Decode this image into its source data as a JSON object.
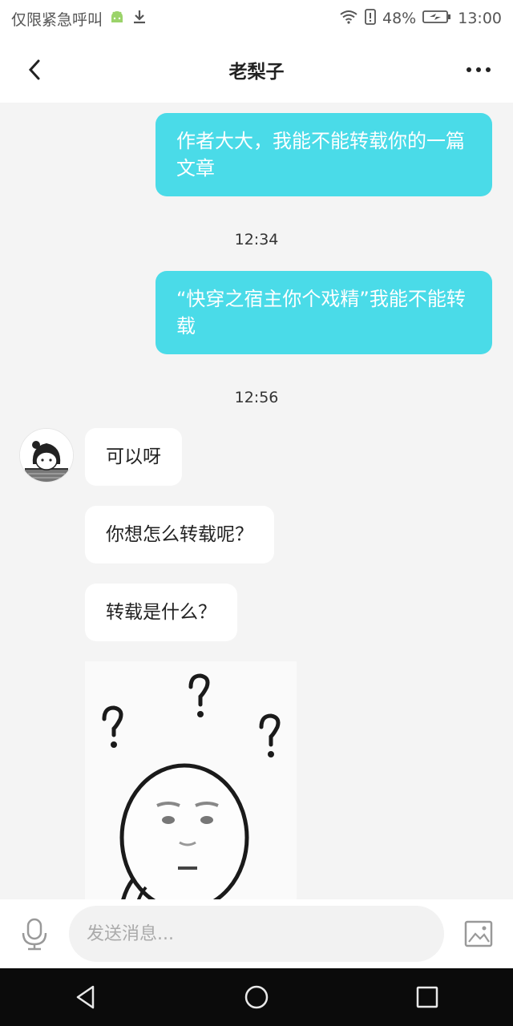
{
  "status_bar": {
    "carrier_text": "仅限紧急呼叫",
    "battery": "48%",
    "time": "13:00"
  },
  "header": {
    "title": "老梨子"
  },
  "messages": {
    "out1": "作者大大，我能不能转载你的一篇文章",
    "time1": "12:34",
    "out2": "“快穿之宿主你个戏精”我能不能转载",
    "time2": "12:56",
    "in1": "可以呀",
    "in2": "你想怎么转载呢？",
    "in3": "转载是什么？"
  },
  "input_bar": {
    "placeholder": "发送消息..."
  },
  "colors": {
    "accent": "#4adbe8",
    "background": "#f4f4f4"
  }
}
